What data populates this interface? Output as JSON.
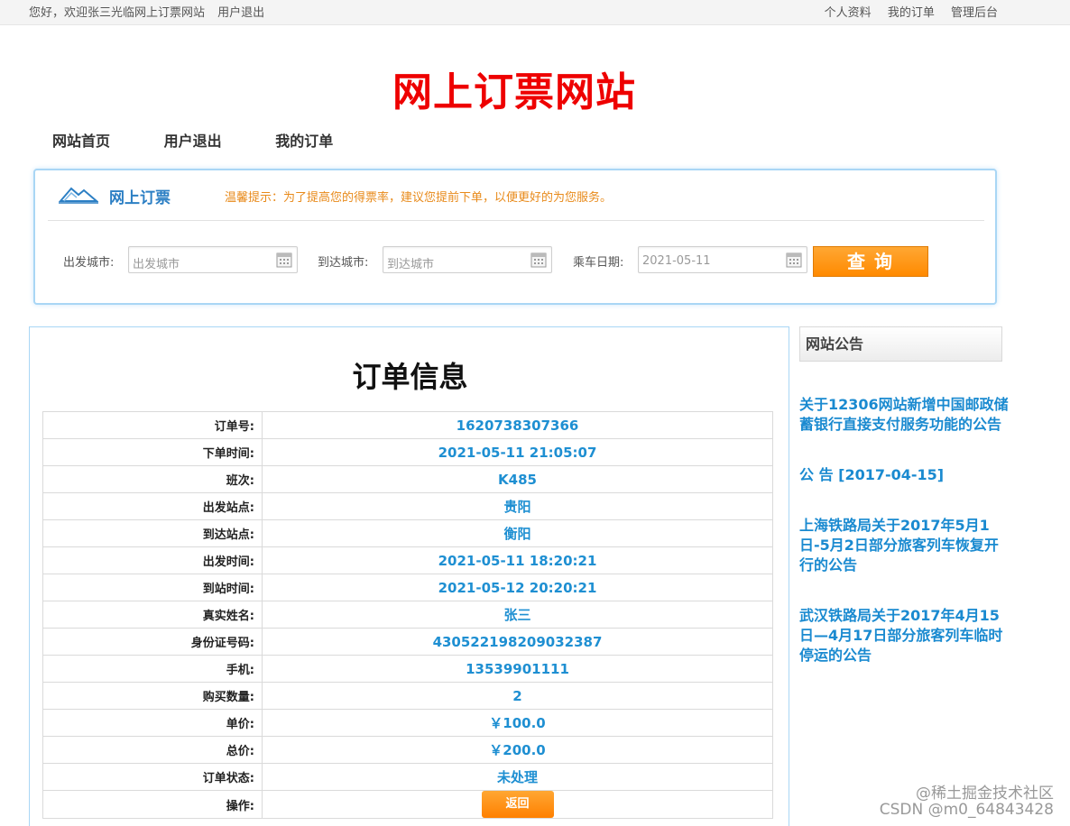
{
  "topbar": {
    "welcome": "您好，欢迎张三光临网上订票网站",
    "logout": "用户退出",
    "links": [
      "个人资料",
      "我的订单",
      "管理后台"
    ]
  },
  "site_title": "网上订票网站",
  "nav": [
    "网站首页",
    "用户退出",
    "我的订单"
  ],
  "search": {
    "title": "网上订票",
    "tip": "温馨提示：为了提高您的得票率，建议您提前下单，以便更好的为您服务。",
    "from_label": "出发城市:",
    "from_placeholder": "出发城市",
    "to_label": "到达城市:",
    "to_placeholder": "到达城市",
    "date_label": "乘车日期:",
    "date_value": "2021-05-11",
    "query_button": "查询",
    "icon_names": [
      "mountain-logo-icon",
      "calendar-icon"
    ]
  },
  "order": {
    "title": "订单信息",
    "rows": [
      {
        "label": "订单号:",
        "value": "1620738307366"
      },
      {
        "label": "下单时间:",
        "value": "2021-05-11 21:05:07"
      },
      {
        "label": "班次:",
        "value": "K485"
      },
      {
        "label": "出发站点:",
        "value": "贵阳"
      },
      {
        "label": "到达站点:",
        "value": "衡阳"
      },
      {
        "label": "出发时间:",
        "value": "2021-05-11 18:20:21"
      },
      {
        "label": "到站时间:",
        "value": "2021-05-12 20:20:21"
      },
      {
        "label": "真实姓名:",
        "value": "张三"
      },
      {
        "label": "身份证号码:",
        "value": "430522198209032387"
      },
      {
        "label": "手机:",
        "value": "13539901111"
      },
      {
        "label": "购买数量:",
        "value": "2"
      },
      {
        "label": "单价:",
        "value": "￥100.0"
      },
      {
        "label": "总价:",
        "value": "￥200.0"
      },
      {
        "label": "订单状态:",
        "value": "未处理"
      }
    ],
    "action_label": "操作:",
    "back_button": "返回"
  },
  "notices": {
    "title": "网站公告",
    "items": [
      "关于12306网站新增中国邮政储蓄银行直接支付服务功能的公告",
      "公 告 [2017-04-15]",
      "上海铁路局关于2017年5月1日-5月2日部分旅客列车恢复开行的公告",
      "武汉铁路局关于2017年4月15日—4月17日部分旅客列车临时停运的公告"
    ]
  },
  "watermark": {
    "line1": "@稀土掘金技术社区",
    "line2": "CSDN @m0_64843428"
  },
  "colors": {
    "title_red": "#ee0000",
    "link_blue": "#1a8ad0",
    "tip_orange": "#e88a1a",
    "button_orange": "#ff8a00",
    "box_border": "#a9d6f5"
  }
}
